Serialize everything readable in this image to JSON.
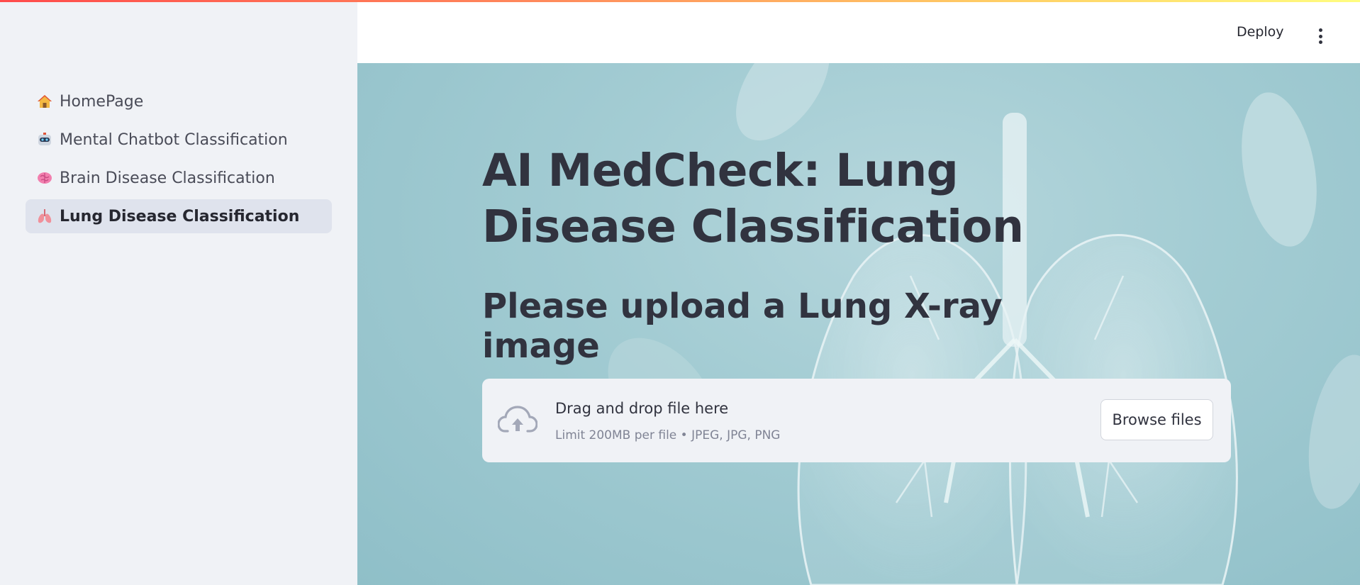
{
  "sidebar": {
    "items": [
      {
        "label": "HomePage",
        "icon": "house-icon",
        "active": false
      },
      {
        "label": "Mental Chatbot Classification",
        "icon": "robot-icon",
        "active": false
      },
      {
        "label": "Brain Disease Classification",
        "icon": "brain-icon",
        "active": false
      },
      {
        "label": "Lung Disease Classification",
        "icon": "lungs-icon",
        "active": true
      }
    ]
  },
  "header": {
    "deploy_label": "Deploy",
    "menu_icon": "more-vertical-icon"
  },
  "main": {
    "title": "AI MedCheck: Lung Disease Classification",
    "subtitle": "Please upload a Lung X-ray image",
    "uploader": {
      "icon": "cloud-upload-icon",
      "drag_text": "Drag and drop file here",
      "limit_text": "Limit 200MB per file • JPEG, JPG, PNG",
      "browse_label": "Browse files"
    }
  },
  "colors": {
    "accent_gradient": [
      "#ff4b4b",
      "#fffd80"
    ],
    "sidebar_bg": "#f0f2f6",
    "active_item_bg": "#dfe3ed",
    "main_bg": "#a3ccd3",
    "text": "#31333f"
  }
}
